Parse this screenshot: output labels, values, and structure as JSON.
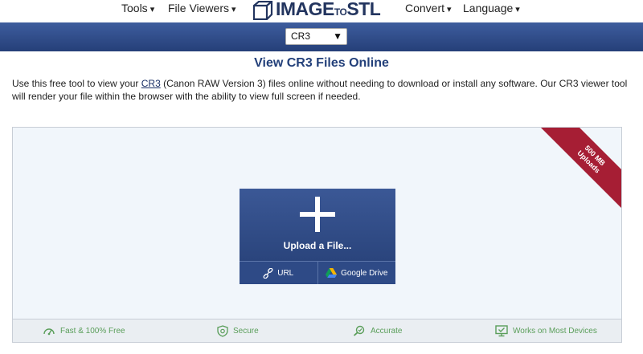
{
  "nav": {
    "tools": "Tools",
    "file_viewers": "File Viewers",
    "convert": "Convert",
    "language": "Language",
    "arrow": "▾"
  },
  "logo": {
    "text_main": "IMAGE",
    "text_to": "TO",
    "text_end": "STL"
  },
  "format_select": {
    "value": "CR3",
    "caret": "▼"
  },
  "title": "View CR3 Files Online",
  "description": {
    "before": "Use this free tool to view your ",
    "link": "CR3",
    "after": " (Canon RAW Version 3) files online without needing to download or install any software. Our CR3 viewer tool will render your file within the browser with the ability to view full screen if needed."
  },
  "ribbon": {
    "line1": "500 MB",
    "line2": "Uploads"
  },
  "upload": {
    "label": "Upload a File...",
    "url_label": "URL",
    "gdrive_label": "Google Drive"
  },
  "features": [
    {
      "label": "Fast & 100% Free",
      "icon": "speedometer-icon"
    },
    {
      "label": "Secure",
      "icon": "shield-icon"
    },
    {
      "label": "Accurate",
      "icon": "magnifier-icon"
    },
    {
      "label": "Works on Most Devices",
      "icon": "monitor-icon"
    }
  ],
  "colors": {
    "brand_navy": "#23355f",
    "bar_blue": "#2e4a86",
    "ribbon_red": "#a61e34",
    "feature_green": "#5a9e5a"
  }
}
